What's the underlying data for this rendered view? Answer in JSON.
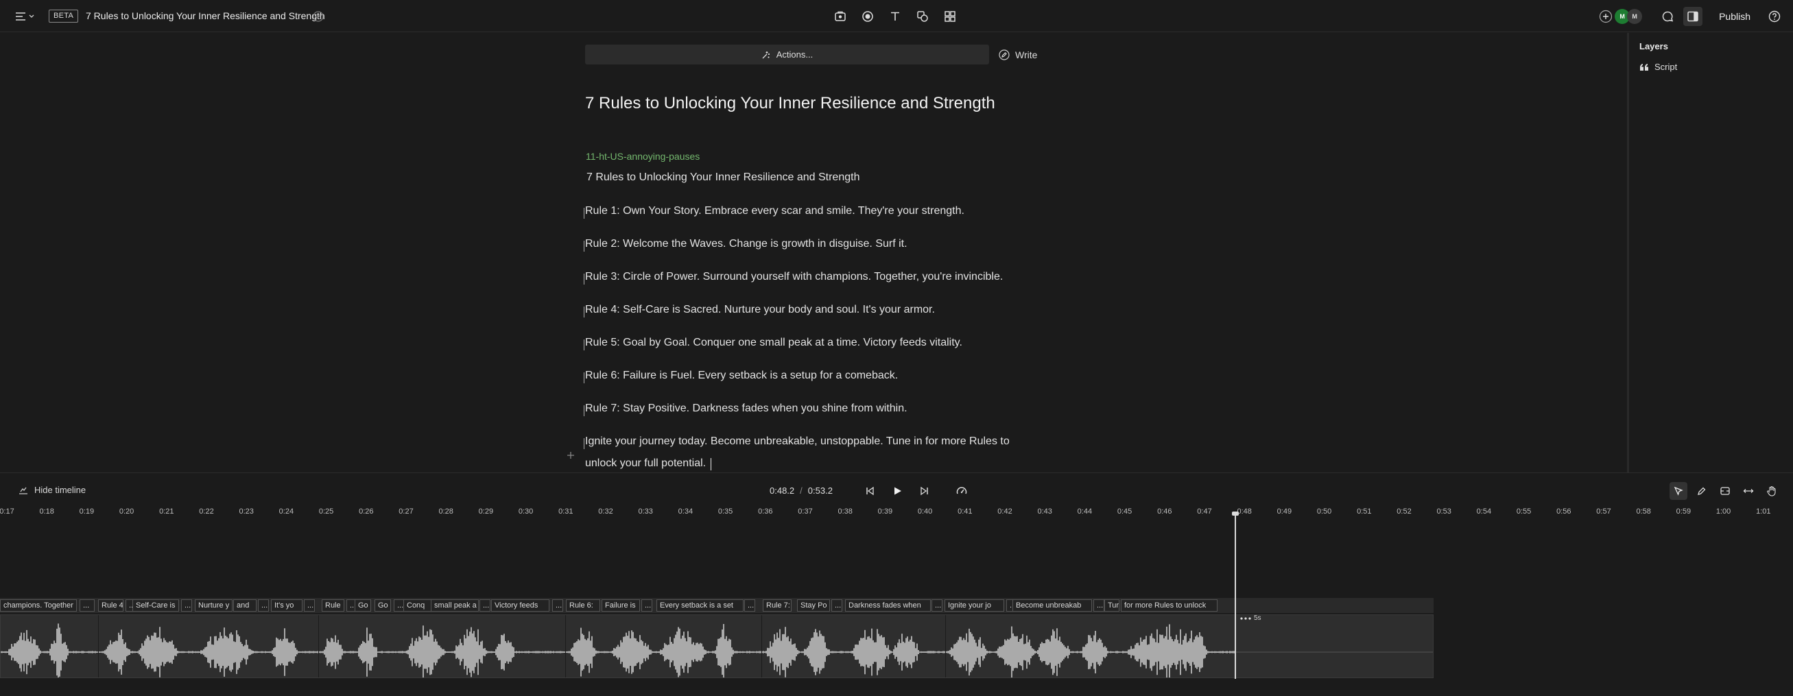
{
  "header": {
    "beta_badge": "BETA",
    "doc_title": "7 Rules to Unlocking Your Inner Resilience and Strength",
    "avatars": [
      {
        "initials": "M",
        "color": "#1e7d32"
      },
      {
        "initials": "M",
        "color": "#3a3a3a"
      }
    ],
    "publish_label": "Publish"
  },
  "editor": {
    "actions_label": "Actions...",
    "write_label": "Write",
    "title": "7 Rules to Unlocking Your Inner Resilience and Strength",
    "speaker": "11-ht-US-annoying-pauses",
    "speaker_color": "#74b86e",
    "paragraphs": [
      "7 Rules to Unlocking Your Inner Resilience and Strength",
      "Rule 1: Own Your Story. Embrace every scar and smile. They're your strength.",
      "Rule 2: Welcome the Waves. Change is growth in disguise. Surf it.",
      "Rule 3: Circle of Power. Surround yourself with champions. Together, you're invincible.",
      "Rule 4: Self-Care is Sacred. Nurture your body and soul. It's your armor.",
      "Rule 5: Goal by Goal. Conquer one small peak at a time. Victory feeds vitality.",
      "Rule 6: Failure is Fuel. Every setback is a setup for a comeback.",
      "Rule 7: Stay Positive. Darkness fades when you shine from within.",
      "Ignite your journey today. Become unbreakable, unstoppable. Tune in for more Rules to",
      "unlock your full potential."
    ]
  },
  "layers": {
    "title": "Layers",
    "items": [
      {
        "label": "Script",
        "icon": "quote-icon"
      }
    ]
  },
  "timeline": {
    "hide_label": "Hide timeline",
    "current_time": "0:48.2",
    "separator": "/",
    "total_time": "0:53.2",
    "ruler_ticks": [
      "0:17",
      "0:18",
      "0:19",
      "0:20",
      "0:21",
      "0:22",
      "0:23",
      "0:24",
      "0:25",
      "0:26",
      "0:27",
      "0:28",
      "0:29",
      "0:30",
      "0:31",
      "0:32",
      "0:33",
      "0:34",
      "0:35",
      "0:36",
      "0:37",
      "0:38",
      "0:39",
      "0:40",
      "0:41",
      "0:42",
      "0:43",
      "0:44",
      "0:45",
      "0:46",
      "0:47",
      "0:48",
      "0:49",
      "0:50",
      "0:51",
      "0:52",
      "0:53",
      "0:54",
      "0:55",
      "0:56",
      "0:57",
      "0:58",
      "0:59",
      "1:00",
      "1:01",
      "1:"
    ],
    "words": [
      "champions. Together",
      "...",
      "Rule 4",
      "...",
      "Self-Care is",
      "...",
      "Nurture y",
      "and",
      "...",
      "It's yo",
      "...",
      "Rule",
      "...",
      "Go",
      "Go",
      "...",
      "Conq",
      "small peak a",
      "...",
      "Victory feeds",
      "...",
      "Rule 6:",
      "Failure is",
      "...",
      "Every setback is a set",
      "...",
      "Rule 7:",
      "Stay Po",
      "...",
      "Darkness fades when",
      "...",
      "Ignite your jo",
      "...",
      "Become unbreakab",
      "...",
      "Tur",
      "for more Rules to unlock"
    ],
    "gap_label": "5s",
    "gap_icon": "ellipsis-icon"
  }
}
